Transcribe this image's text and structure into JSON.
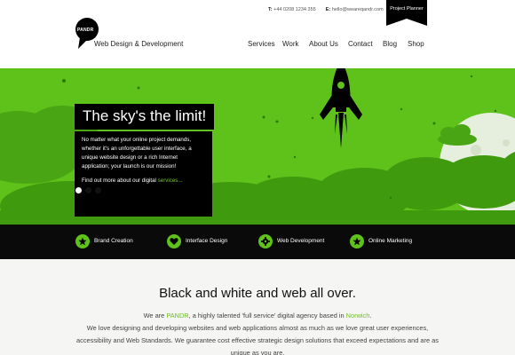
{
  "header": {
    "logo_text": "PANDR",
    "tagline": "Web Design & Development",
    "contact": {
      "phone_label": "T:",
      "phone": "+44 0208 1234 355",
      "email_label": "E:",
      "email": "hello@weareqandr.com"
    },
    "planner_label": "Project Planner",
    "nav": [
      "Services",
      "Work",
      "About Us",
      "Contact",
      "Blog",
      "Shop"
    ]
  },
  "hero": {
    "title": "The sky's the limit!",
    "body": "No matter what your online project demands, whether it's an unforgettable user interface, a unique website design or a rich Internet application; your launch is our mission!",
    "cta_prefix": "Find out more about our digital",
    "cta_link": "services...",
    "slides": 3,
    "active_slide": 1
  },
  "services_bar": [
    {
      "label": "Brand Creation",
      "icon": "star-icon"
    },
    {
      "label": "Interface Design",
      "icon": "heart-icon"
    },
    {
      "label": "Web Development",
      "icon": "gear-icon"
    },
    {
      "label": "Online Marketing",
      "icon": "star-icon"
    }
  ],
  "intro": {
    "title": "Black and white and web all over.",
    "line1_a": "We are ",
    "line1_company": "PANDR",
    "line1_b": ", a highly talented 'full service' digital agency based in ",
    "line1_city": "Norwich",
    "line1_c": ".",
    "rest": "We love designing and developing websites and web applications almost as much as we love great user experiences, accessibility and Web Standards. We guarantee cost effective strategic design solutions that exceed expectations and are as unique as you are."
  },
  "colors": {
    "brand_green": "#5fc21a",
    "dark_green": "#3f9a0e",
    "black": "#000000",
    "intro_bg": "#f5f5f3"
  }
}
